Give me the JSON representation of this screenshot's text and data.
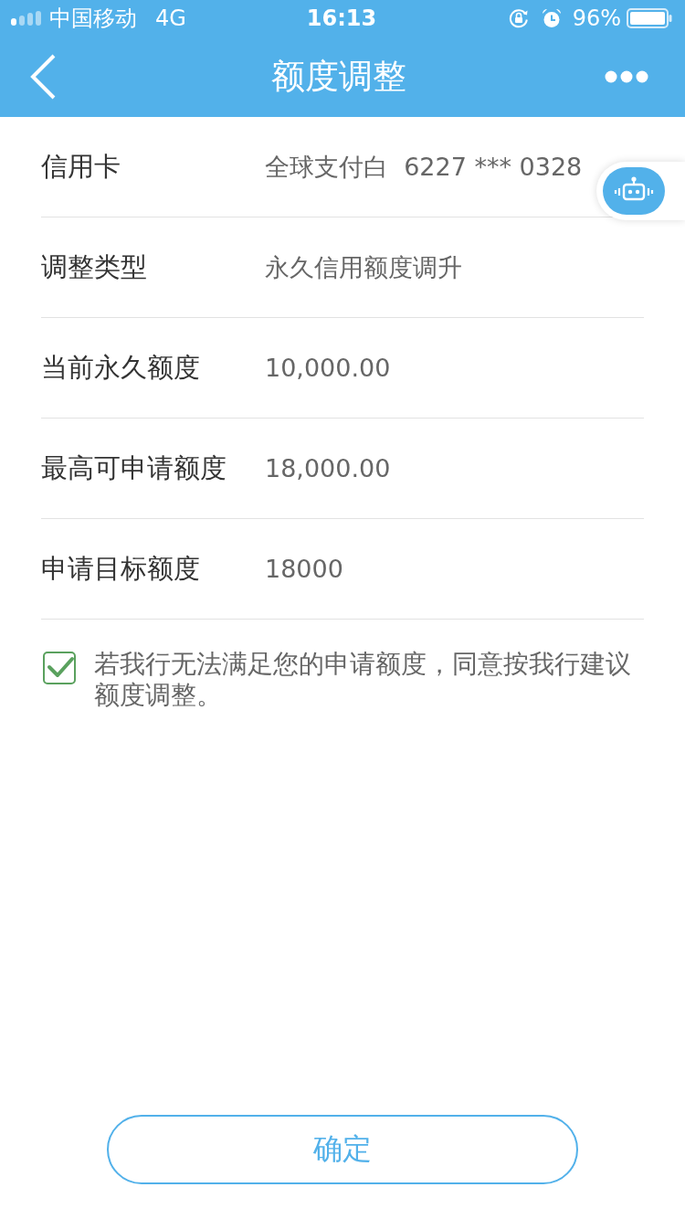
{
  "status_bar": {
    "carrier": "中国移动",
    "network": "4G",
    "time": "16:13",
    "battery": "96%"
  },
  "nav_bar": {
    "title": "额度调整"
  },
  "fields": [
    {
      "label": "信用卡",
      "value": "全球支付白  6227 *** 0328"
    },
    {
      "label": "调整类型",
      "value": "永久信用额度调升"
    },
    {
      "label": "当前永久额度",
      "value": "10,000.00"
    },
    {
      "label": "最高可申请额度",
      "value": "18,000.00"
    },
    {
      "label": "申请目标额度",
      "value": "18000"
    }
  ],
  "agreement": {
    "checked": true,
    "text": "若我行无法满足您的申请额度，同意按我行建议额度调整。"
  },
  "confirm_button": {
    "label": "确定"
  }
}
